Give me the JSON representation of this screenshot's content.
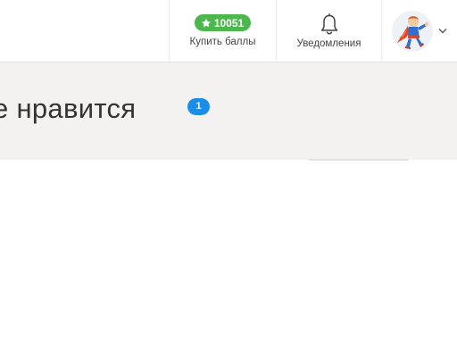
{
  "header": {
    "points": {
      "value": "10051",
      "label": "Купить баллы",
      "badge_color": "#4cb74d",
      "icon": "star-icon"
    },
    "notifications": {
      "label": "Уведомления",
      "icon": "bell-icon"
    },
    "profile": {
      "avatar": "superhero-avatar",
      "menu_icon": "chevron-down-icon"
    }
  },
  "page": {
    "title": "е нравится",
    "count": "1",
    "count_color": "#1a8ee6"
  }
}
